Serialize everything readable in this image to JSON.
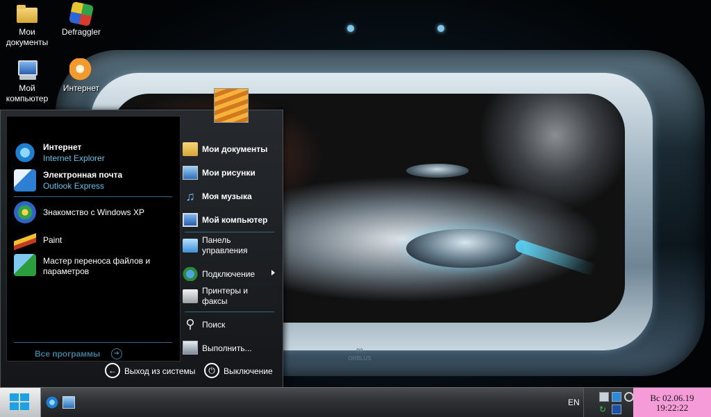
{
  "desktop": {
    "icons": [
      {
        "label": "Мои документы",
        "icon": "folder-icon"
      },
      {
        "label": "Defraggler",
        "icon": "defraggler-icon"
      },
      {
        "label": "Мой компьютер",
        "icon": "computer-icon"
      },
      {
        "label": "Интернет",
        "icon": "browser-fox-icon"
      }
    ],
    "wallpaper_brand": "ORBLUS"
  },
  "start_menu": {
    "pinned": [
      {
        "title": "Интернет",
        "subtitle": "Internet Explorer",
        "icon": "internet-explorer-icon"
      },
      {
        "title": "Электронная почта",
        "subtitle": "Outlook Express",
        "icon": "outlook-express-icon"
      }
    ],
    "recent": [
      {
        "label": "Знакомство с Windows XP",
        "icon": "windows-tour-icon"
      },
      {
        "label": "Paint",
        "icon": "paint-icon"
      },
      {
        "label": "Мастер переноса файлов и параметров",
        "icon": "transfer-wizard-icon"
      }
    ],
    "all_programs": "Все программы",
    "right_items": [
      {
        "label": "Мои документы",
        "icon": "my-documents-icon"
      },
      {
        "label": "Мои рисунки",
        "icon": "my-pictures-icon"
      },
      {
        "label": "Моя музыка",
        "icon": "my-music-icon"
      },
      {
        "label": "Мой компьютер",
        "icon": "my-computer-icon"
      },
      {
        "label": "Панель управления",
        "icon": "control-panel-icon"
      },
      {
        "label": "Подключение",
        "icon": "connect-icon"
      },
      {
        "label": "Принтеры и факсы",
        "icon": "printers-icon"
      },
      {
        "label": "Поиск",
        "icon": "search-icon"
      },
      {
        "label": "Выполнить...",
        "icon": "run-icon"
      }
    ],
    "logoff": "Выход из системы",
    "shutdown": "Выключение"
  },
  "taskbar": {
    "language": "EN",
    "date": "Вс 02.06.19",
    "time": "19:22:22"
  },
  "colors": {
    "accent_blue": "#5ec3e8",
    "clock_bg": "#f59bd8",
    "start_blue": "#1da1e2"
  }
}
